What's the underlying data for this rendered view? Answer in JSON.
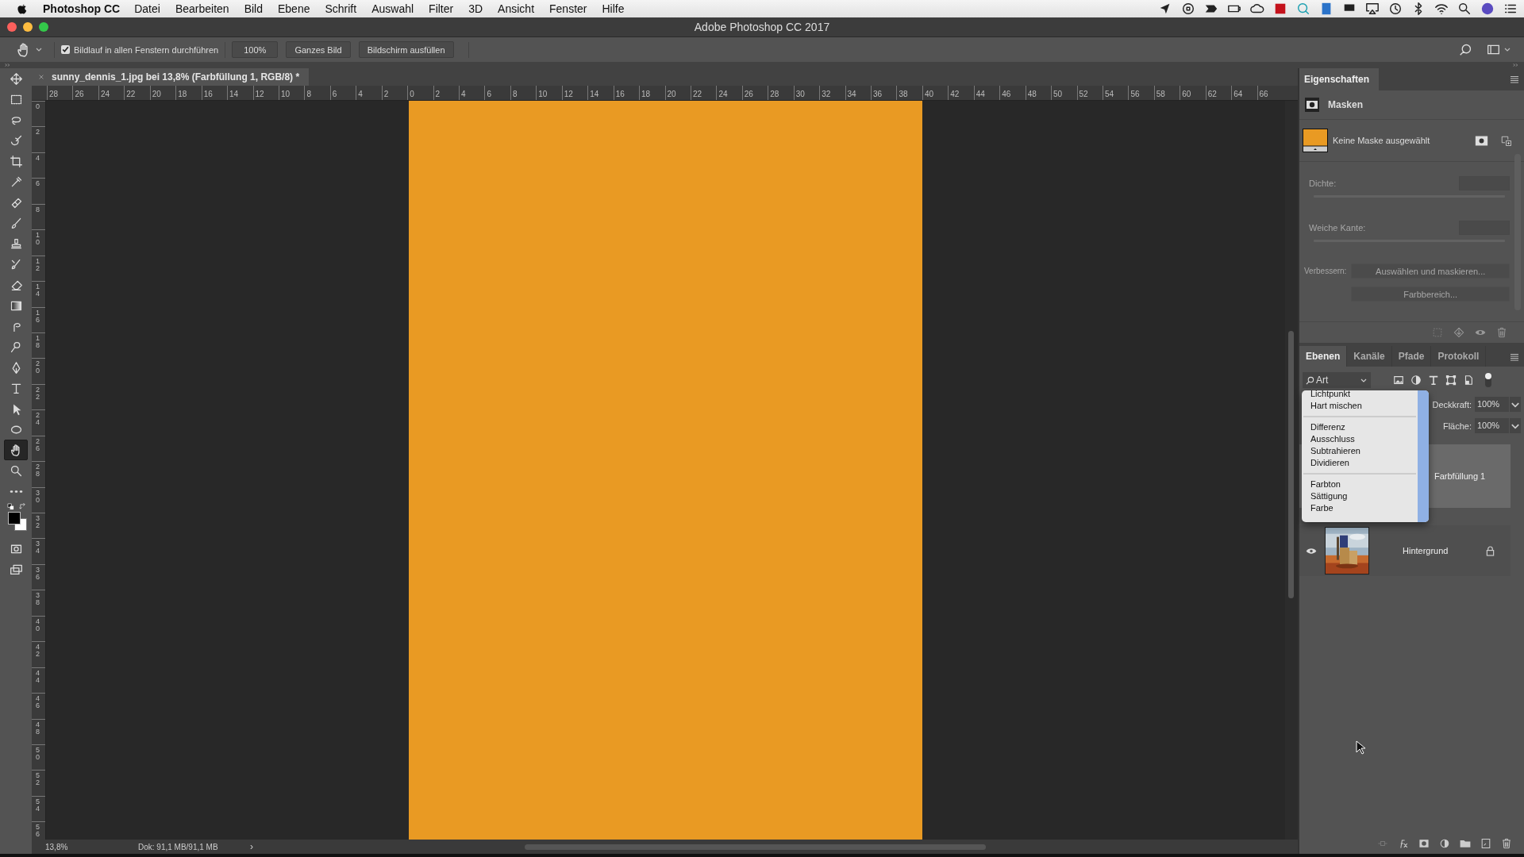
{
  "menu_bar": {
    "app": "Photoshop CC",
    "items": [
      "Datei",
      "Bearbeiten",
      "Bild",
      "Ebene",
      "Schrift",
      "Auswahl",
      "Filter",
      "3D",
      "Ansicht",
      "Fenster",
      "Hilfe"
    ]
  },
  "window": {
    "title": "Adobe Photoshop CC 2017"
  },
  "options_bar": {
    "scroll_all": {
      "label": "Bildlauf in allen Fenstern durchführen",
      "checked": true
    },
    "buttons": [
      "100%",
      "Ganzes Bild",
      "Bildschirm ausfüllen"
    ]
  },
  "tools": [
    {
      "kind": "move",
      "selected": false
    },
    {
      "kind": "marquee",
      "selected": false
    },
    {
      "kind": "lasso",
      "selected": false
    },
    {
      "kind": "quick",
      "selected": false
    },
    {
      "kind": "crop",
      "selected": false
    },
    {
      "kind": "eyedropper",
      "selected": false
    },
    {
      "kind": "bandage",
      "selected": false
    },
    {
      "kind": "brush",
      "selected": false
    },
    {
      "kind": "stamp",
      "selected": false
    },
    {
      "kind": "history",
      "selected": false
    },
    {
      "kind": "eraser",
      "selected": false
    },
    {
      "kind": "gradient",
      "selected": false
    },
    {
      "kind": "smudge",
      "selected": false
    },
    {
      "kind": "dodge",
      "selected": false
    },
    {
      "kind": "pen",
      "selected": false
    },
    {
      "kind": "type",
      "selected": false
    },
    {
      "kind": "pointer",
      "selected": false
    },
    {
      "kind": "ellipse",
      "selected": false
    },
    {
      "kind": "hand",
      "selected": true
    },
    {
      "kind": "zoom",
      "selected": false
    },
    {
      "kind": "more",
      "selected": false
    },
    {
      "kind": "colors",
      "selected": false
    },
    {
      "kind": "quickmask",
      "selected": false
    },
    {
      "kind": "screen",
      "selected": false
    }
  ],
  "document": {
    "tab": "sunny_dennis_1.jpg bei 13,8% (Farbfüllung 1, RGB/8) *"
  },
  "rulers": {
    "horizontal": [
      "28",
      "26",
      "24",
      "22",
      "20",
      "18",
      "16",
      "14",
      "12",
      "10",
      "8",
      "6",
      "4",
      "2",
      "0",
      "2",
      "4",
      "6",
      "8",
      "10",
      "12",
      "14",
      "16",
      "18",
      "20",
      "22",
      "24",
      "26",
      "28",
      "30",
      "32",
      "34",
      "36",
      "38",
      "40",
      "42",
      "44",
      "46",
      "48",
      "50",
      "52",
      "54",
      "56",
      "58",
      "60",
      "62",
      "64",
      "66"
    ],
    "vertical": [
      "0",
      "2",
      "4",
      "6",
      "8",
      "10",
      "12",
      "14",
      "16",
      "18",
      "20",
      "22",
      "24",
      "26",
      "28",
      "30",
      "32",
      "34",
      "36",
      "38",
      "40",
      "42",
      "44",
      "46",
      "48",
      "50",
      "52",
      "54",
      "56"
    ]
  },
  "status_bar": {
    "zoom": "13,8%",
    "doc": "Dok: 91,1 MB/91,1 MB",
    "arrow": "›"
  },
  "properties": {
    "title": "Eigenschaften",
    "section": "Masken",
    "mask_status": "Keine Maske ausgewählt",
    "disabled": true,
    "fields": [
      "Dichte:",
      "Weiche Kante:"
    ],
    "refine_label": "Verbessern:",
    "buttons": [
      "Auswählen und maskieren...",
      "Farbbereich..."
    ]
  },
  "layers_panel": {
    "tabs": [
      {
        "label": "Ebenen",
        "selected": true
      },
      {
        "label": "Kanäle",
        "selected": false
      },
      {
        "label": "Pfade",
        "selected": false
      },
      {
        "label": "Protokoll",
        "selected": false
      }
    ],
    "filter": "Art",
    "opacity": {
      "label": "Deckkraft:",
      "value": "100%"
    },
    "fill": {
      "label": "Fläche:",
      "value": "100%"
    },
    "layers": [
      {
        "name": "Farbfüllung 1",
        "kind": "fill",
        "selected": true
      },
      {
        "name": "Hintergrund",
        "selected": false
      }
    ]
  },
  "blend_menu": {
    "groups": [
      [
        "Lichtpunkt",
        "Hart mischen"
      ],
      [
        "Differenz",
        "Ausschluss",
        "Subtrahieren",
        "Dividieren"
      ],
      [
        "Farbton",
        "Sättigung",
        "Farbe"
      ]
    ]
  }
}
